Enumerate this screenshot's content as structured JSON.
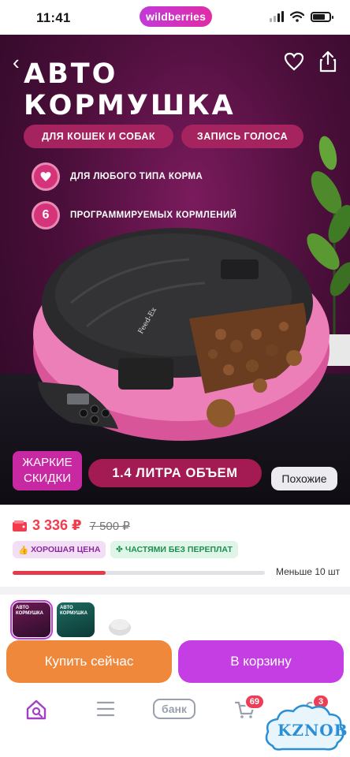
{
  "status_bar": {
    "time": "11:41",
    "brand": "wildberries"
  },
  "hero": {
    "title_line1": "АВТО",
    "title_line2": "КОРМУШКА",
    "tags": [
      "ДЛЯ КОШЕК И СОБАК",
      "ЗАПИСЬ ГОЛОСА"
    ],
    "features": [
      {
        "icon": "heart-icon",
        "text": "ДЛЯ ЛЮБОГО ТИПА КОРМА"
      },
      {
        "badge": "6",
        "text": "ПРОГРАММИРУЕМЫХ КОРМЛЕНИЙ"
      }
    ],
    "device_label": "Feed-Ex",
    "promo": {
      "line1": "ЖАРКИЕ",
      "line2": "СКИДКИ"
    },
    "volume_label": "1.4 ЛИТРА ОБЪЕМ",
    "similar_button": "Похожие"
  },
  "price": {
    "current": "3 336 ₽",
    "old": "7 500 ₽"
  },
  "badges": {
    "good_price": "ХОРОШАЯ ЦЕНА",
    "installments": "ЧАСТЯМИ БЕЗ ПЕРЕПЛАТ"
  },
  "stock": {
    "text": "Меньше 10 шт",
    "level": 0.37
  },
  "thumbnails": [
    {
      "title_line1": "АВТО",
      "title_line2": "КОРМУШКА"
    },
    {
      "title_line1": "АВТО",
      "title_line2": "КОРМУШКА"
    }
  ],
  "actions": {
    "buy_now": "Купить сейчас",
    "to_cart": "В корзину"
  },
  "tabbar": {
    "bank": "банк",
    "cart_count": "69",
    "profile_count": "3"
  },
  "watermark": "KZNOB",
  "colors": {
    "brand": "#c13ad8",
    "price": "#f23c4d",
    "buy_now": "#f0883c",
    "to_cart": "#c53ee4"
  }
}
